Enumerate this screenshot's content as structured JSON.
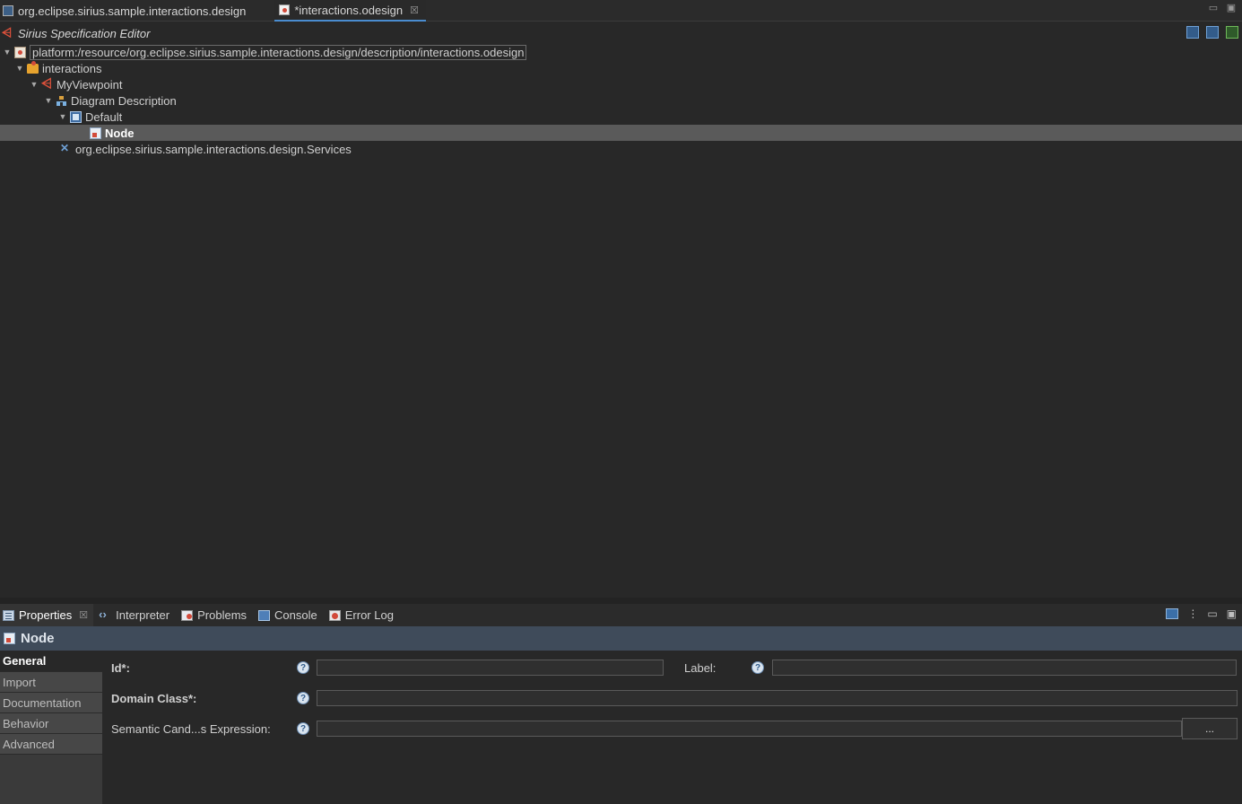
{
  "editor_tabs": [
    {
      "label": "org.eclipse.sirius.sample.interactions.design",
      "icon": "design-project-icon"
    },
    {
      "label": "*interactions.odesign",
      "icon": "odesign-file-icon",
      "close": "☒"
    }
  ],
  "window_controls": {
    "minimize": "▭",
    "maximize": "▣"
  },
  "editor": {
    "title": "Sirius Specification Editor",
    "toolbar": [
      "expand-all-icon",
      "collapse-all-icon",
      "validate-icon"
    ]
  },
  "tree": {
    "root": "platform:/resource/org.eclipse.sirius.sample.interactions.design/description/interactions.odesign",
    "group": "interactions",
    "viewpoint": "MyViewpoint",
    "diagram": "Diagram Description",
    "layer": "Default",
    "node": "Node",
    "services": "org.eclipse.sirius.sample.interactions.design.Services"
  },
  "view_tabs": [
    {
      "label": "Properties",
      "close": "☒"
    },
    {
      "label": "Interpreter"
    },
    {
      "label": "Problems"
    },
    {
      "label": "Console"
    },
    {
      "label": "Error Log"
    }
  ],
  "panel_tools": {
    "menu": "⋮",
    "minimize": "▭",
    "maximize": "▣"
  },
  "properties": {
    "title": "Node",
    "side_tabs": [
      "General",
      "Import",
      "Documentation",
      "Behavior",
      "Advanced"
    ],
    "active_tab": "General",
    "fields": {
      "id_label": "Id*:",
      "id_value": "",
      "label_label": "Label:",
      "label_value": "",
      "domain_class_label": "Domain Class*:",
      "domain_class_value": "",
      "semantic_label": "Semantic Cand...s Expression:",
      "semantic_value": "",
      "browse_button": "..."
    },
    "help_glyph": "?"
  }
}
